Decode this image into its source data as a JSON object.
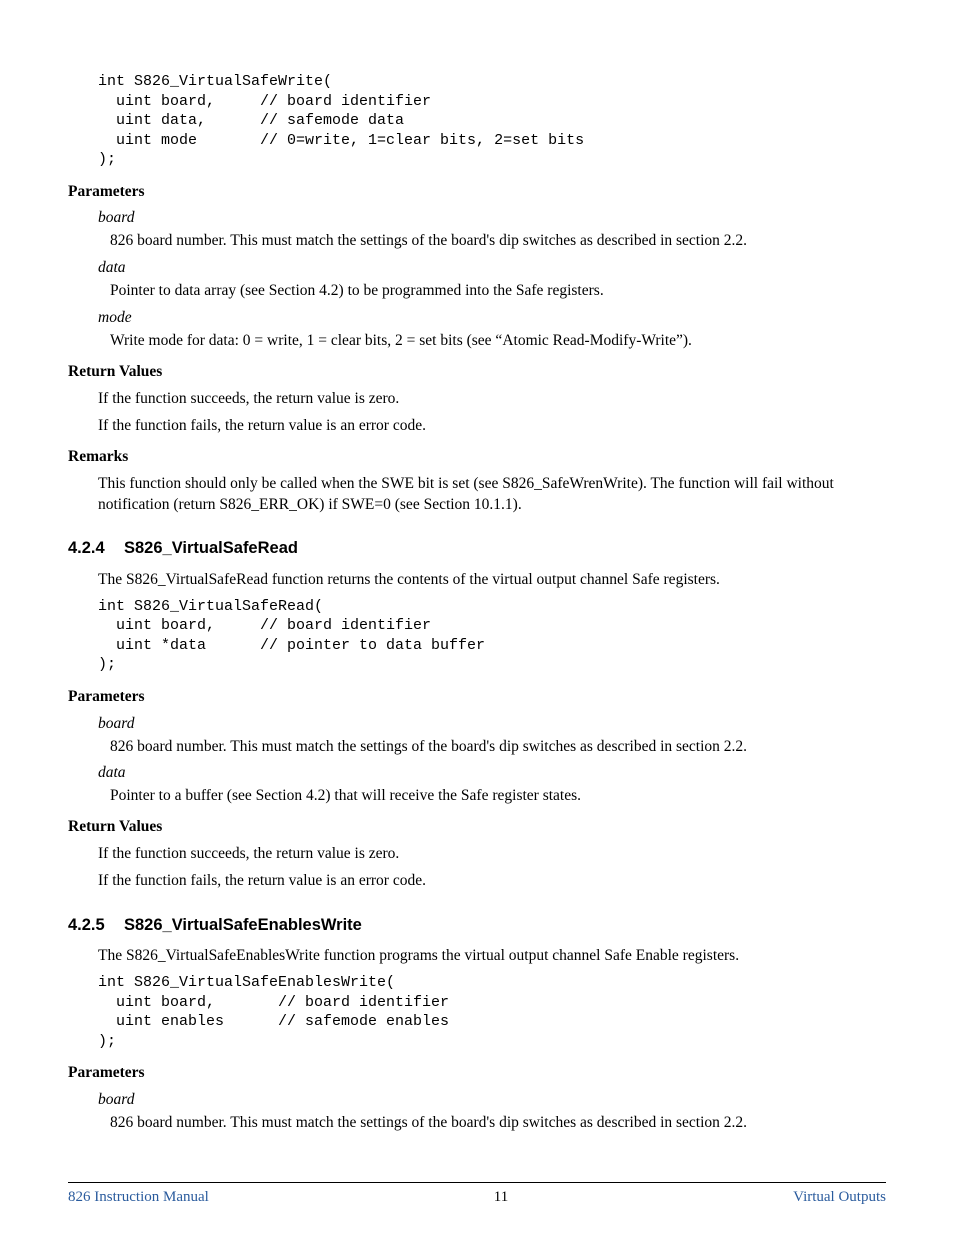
{
  "code1": "int S826_VirtualSafeWrite(\n  uint board,     // board identifier\n  uint data,      // safemode data\n  uint mode       // 0=write, 1=clear bits, 2=set bits\n);",
  "sec1": {
    "params_h": "Parameters",
    "p_board": "board",
    "p_board_d": "826 board number. This must match the settings of the board's dip switches as described in section 2.2.",
    "p_data": "data",
    "p_data_d": "Pointer to data array (see Section 4.2) to be programmed into the Safe registers.",
    "p_mode": "mode",
    "p_mode_d": "Write mode for data: 0 = write, 1 = clear bits, 2 = set bits (see “Atomic Read-Modify-Write”).",
    "ret_h": "Return Values",
    "ret1": "If the function succeeds, the return value is zero.",
    "ret2": "If the function fails, the return value is an error code.",
    "rem_h": "Remarks",
    "rem": "This function should only be called when the SWE bit is set (see S826_SafeWrenWrite). The function will fail without notification (return S826_ERR_OK) if SWE=0 (see Section 10.1.1)."
  },
  "sub424": {
    "num": "4.2.4",
    "title": "S826_VirtualSafeRead",
    "intro": "The S826_VirtualSafeRead function returns the contents of the virtual output channel Safe registers.",
    "code": "int S826_VirtualSafeRead(\n  uint board,     // board identifier\n  uint *data      // pointer to data buffer\n);",
    "params_h": "Parameters",
    "p_board": "board",
    "p_board_d": "826 board number. This must match the settings of the board's dip switches as described in section 2.2.",
    "p_data": "data",
    "p_data_d": "Pointer to a buffer (see Section 4.2) that will receive the Safe register states.",
    "ret_h": "Return Values",
    "ret1": "If the function succeeds, the return value is zero.",
    "ret2": "If the function fails, the return value is an error code."
  },
  "sub425": {
    "num": "4.2.5",
    "title": "S826_VirtualSafeEnablesWrite",
    "intro": "The S826_VirtualSafeEnablesWrite function programs the virtual output channel Safe Enable registers.",
    "code": "int S826_VirtualSafeEnablesWrite(\n  uint board,       // board identifier\n  uint enables      // safemode enables\n);",
    "params_h": "Parameters",
    "p_board": "board",
    "p_board_d": "826 board number. This must match the settings of the board's dip switches as described in section 2.2."
  },
  "footer": {
    "left": "826 Instruction Manual",
    "center": "11",
    "right": "Virtual Outputs"
  }
}
